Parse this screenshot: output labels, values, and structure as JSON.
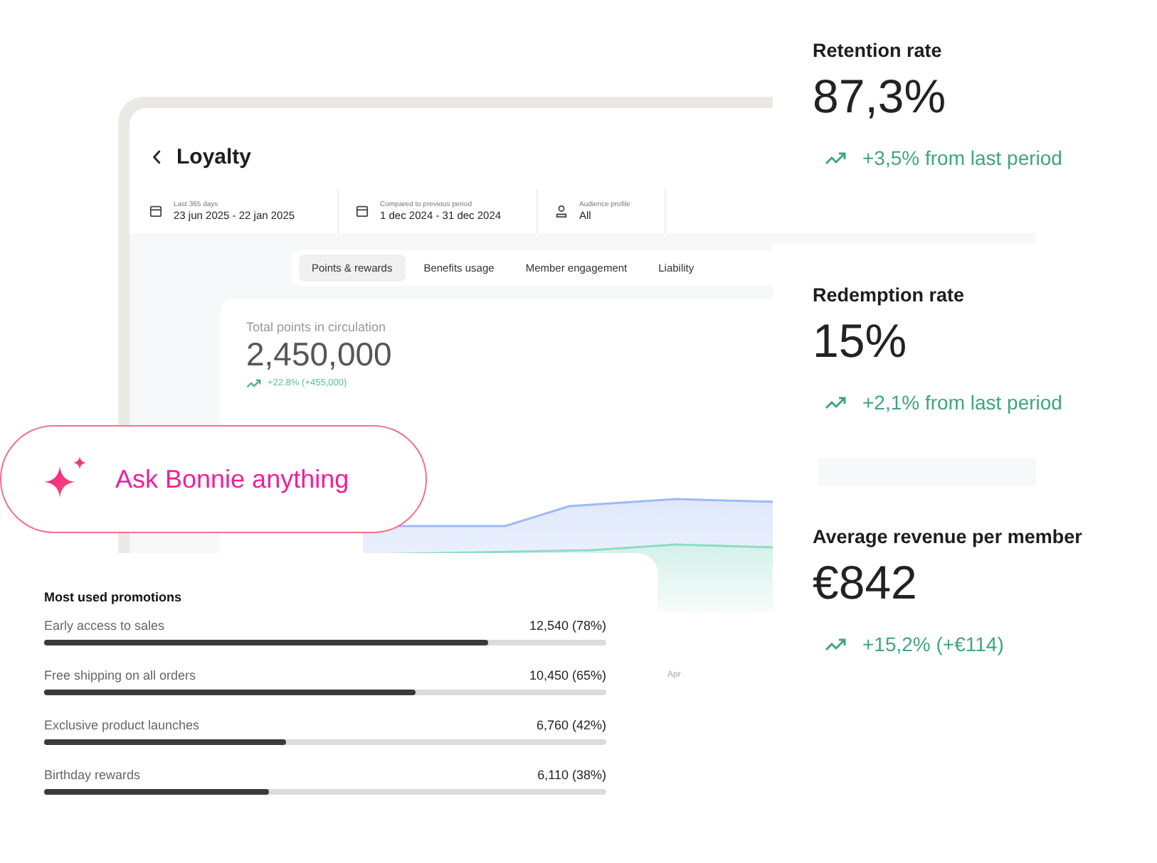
{
  "window": {
    "title": "Loyalty"
  },
  "filters": [
    {
      "kind": "date",
      "caption": "Last 365 days",
      "value": "23 jun 2025 - 22 jan 2025"
    },
    {
      "kind": "date",
      "caption": "Compared to previous period",
      "value": "1 dec 2024 - 31 dec 2024"
    },
    {
      "kind": "audience",
      "caption": "Audience profile",
      "value": "All"
    }
  ],
  "tabs": [
    {
      "label": "Points & rewards",
      "selected": true
    },
    {
      "label": "Benefits usage",
      "selected": false
    },
    {
      "label": "Member engagement",
      "selected": false
    },
    {
      "label": "Liability",
      "selected": false
    }
  ],
  "points_card": {
    "title": "Total points in circulation",
    "value": "2,450,000",
    "change": "+22.8% (+455,000)",
    "chart_axis_label": "Apr"
  },
  "assistant": {
    "label": "Ask Bonnie anything"
  },
  "promotions": {
    "title": "Most used promotions",
    "items": [
      {
        "name": "Early access to sales",
        "reading": "12,540 (78%)",
        "level": 0.79
      },
      {
        "name": "Free shipping on all orders",
        "reading": "10,450 (65%)",
        "level": 0.66
      },
      {
        "name": "Exclusive product launches",
        "reading": "6,760 (42%)",
        "level": 0.43
      },
      {
        "name": "Birthday rewards",
        "reading": "6,110 (38%)",
        "level": 0.4
      }
    ]
  },
  "metrics": [
    {
      "title": "Retention rate",
      "value": "87,3%",
      "change": "+3,5% from last period"
    },
    {
      "title": "Redemption rate",
      "value": "15%",
      "change": "+2,1% from last period"
    },
    {
      "title": "Average revenue per member",
      "value": "€842",
      "change": "+15,2% (+€114)"
    }
  ]
}
